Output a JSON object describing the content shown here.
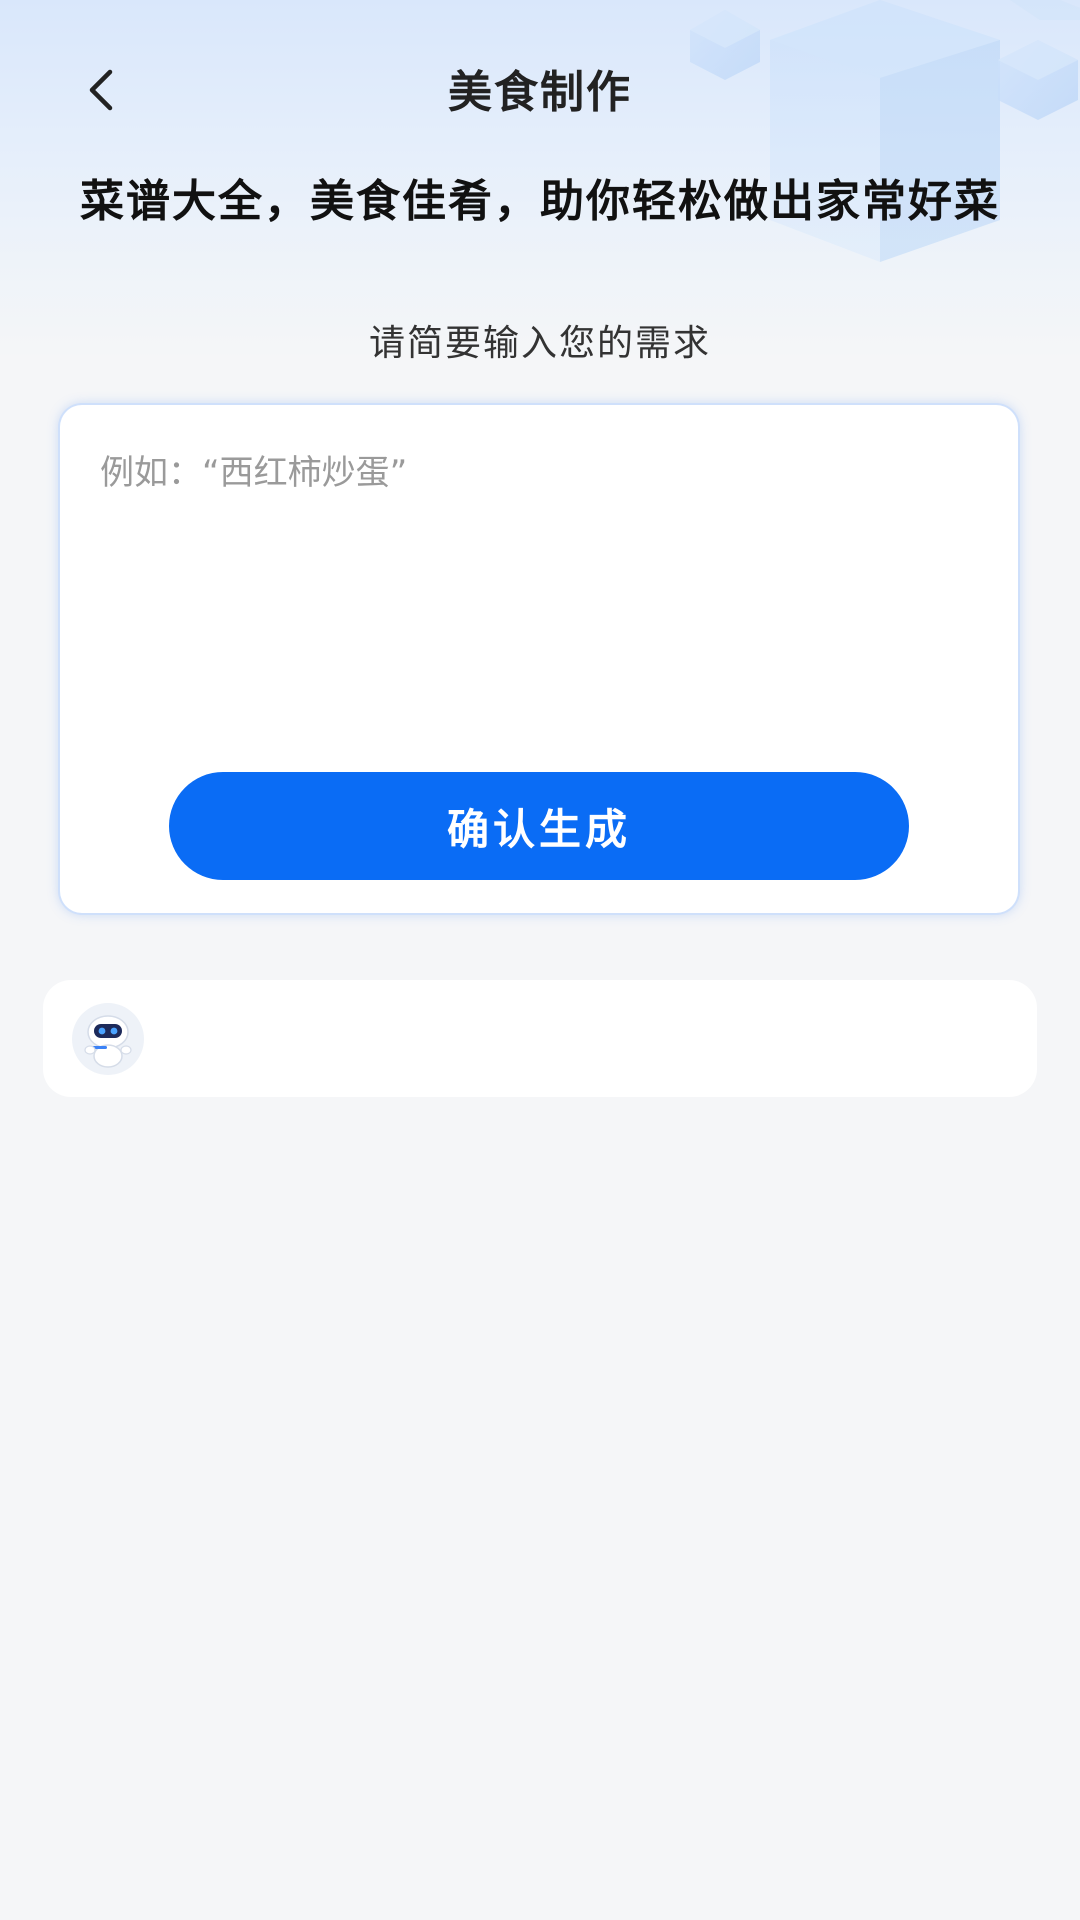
{
  "header": {
    "title": "美食制作",
    "back_icon": "chevron-left-icon"
  },
  "hero": {
    "headline": "菜谱大全，美食佳肴，助你轻松做出家常好菜",
    "subheadline": "请简要输入您的需求"
  },
  "input": {
    "value": "",
    "placeholder": "例如：“西红柿炒蛋”"
  },
  "actions": {
    "confirm_label": "确认生成"
  },
  "result": {
    "avatar_icon": "robot-assistant-icon"
  },
  "colors": {
    "primary": "#0a6cf5",
    "background": "#f5f6f8",
    "card": "#ffffff",
    "header_gradient_top": "#d9e7fb"
  }
}
